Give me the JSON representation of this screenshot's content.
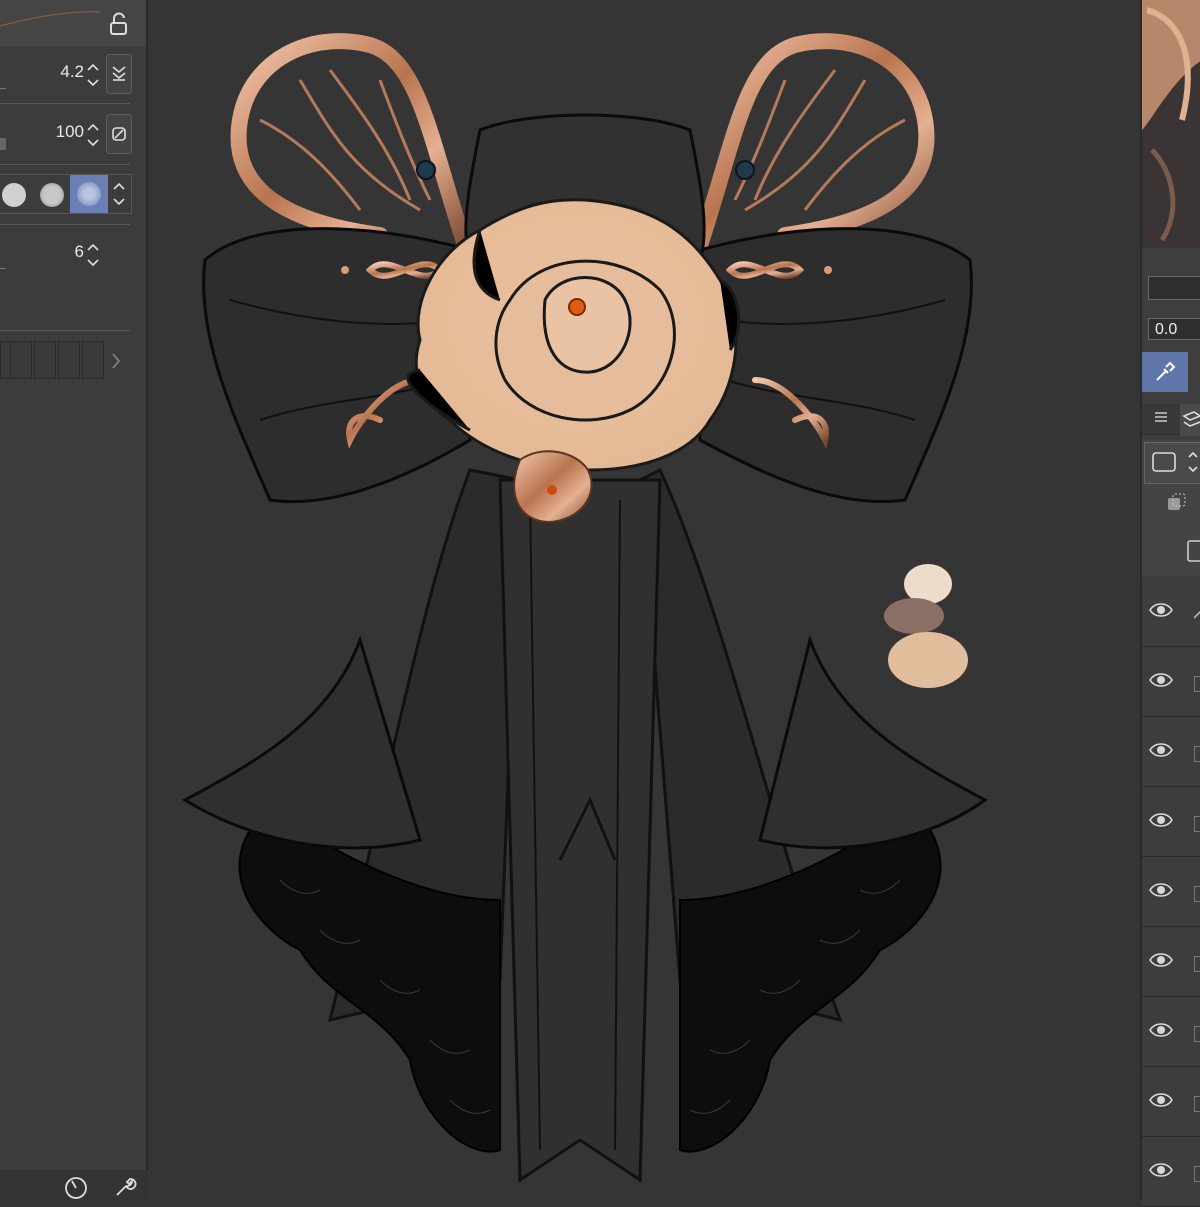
{
  "left_panel": {
    "brush_size": "4.2",
    "opacity": "100",
    "hardness": "6",
    "icons": {
      "lock": "unlock-icon",
      "size_toggle": "pressure-size-icon",
      "opacity_toggle": "pressure-opacity-icon",
      "bottom_left": "timer-dial-icon",
      "bottom_right": "wrench-icon"
    }
  },
  "right_panel": {
    "layer_opacity": "0.0",
    "layers": [
      {
        "visible": true
      },
      {
        "visible": true
      },
      {
        "visible": true
      },
      {
        "visible": true
      },
      {
        "visible": true
      },
      {
        "visible": true
      },
      {
        "visible": true
      },
      {
        "visible": true
      },
      {
        "visible": true
      }
    ]
  },
  "colors": {
    "panel_bg": "#3c3c3c",
    "canvas_bg": "#353535",
    "accent": "#6076a8",
    "rose_gold": "#c88a67",
    "rose_cream": "#e8c3a4",
    "swatch_light": "#eedccb",
    "swatch_mid": "#8c7066",
    "swatch_peach": "#e2bd9c"
  }
}
